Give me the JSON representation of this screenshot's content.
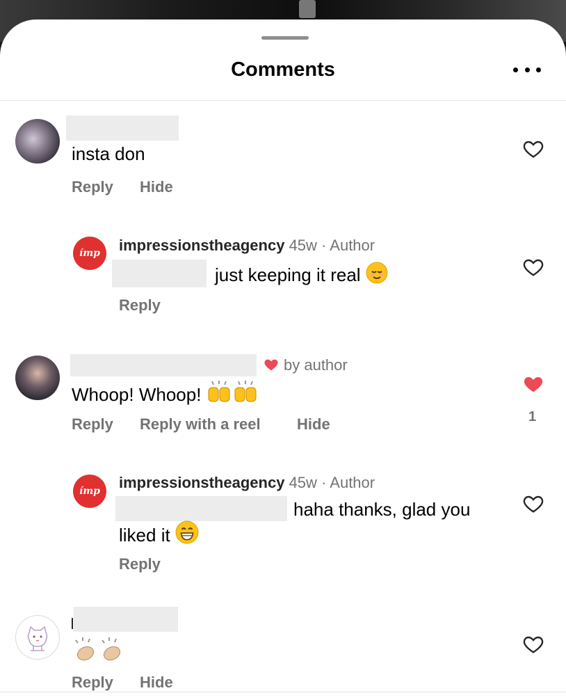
{
  "header": {
    "title": "Comments"
  },
  "comments": [
    {
      "text": "insta don",
      "actions": [
        "Reply",
        "Hide"
      ]
    },
    {
      "username": "impressionstheagency",
      "time": "45w",
      "role": "Author",
      "text": "just keeping it real",
      "emoji": "relieved-face",
      "actions": [
        "Reply"
      ]
    },
    {
      "badge": "by author",
      "text": "Whoop! Whoop!",
      "emoji": "raising-hands x2",
      "actions": [
        "Reply",
        "Reply with a reel",
        "Hide"
      ],
      "likes": "1",
      "liked": true,
      "like_color": "#ed4956"
    },
    {
      "username": "impressionstheagency",
      "time": "45w",
      "role": "Author",
      "text_line1": "haha thanks, glad you",
      "text_line2": "liked it",
      "emoji": "grinning-face",
      "actions": [
        "Reply"
      ]
    },
    {
      "emoji": "clapping-hands x2",
      "actions": [
        "Reply",
        "Hide"
      ]
    }
  ],
  "brand": {
    "avatar_text": "ímp",
    "color": "#e0302f"
  }
}
